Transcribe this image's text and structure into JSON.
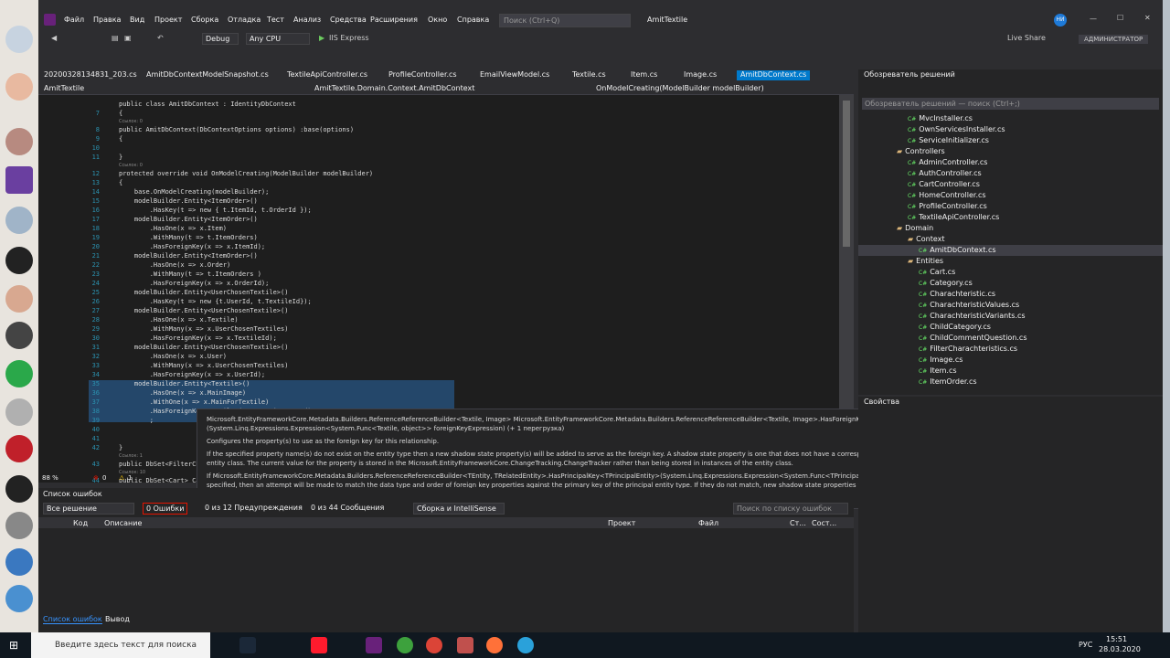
{
  "window": {
    "menu": [
      "Файл",
      "Правка",
      "Вид",
      "Проект",
      "Сборка",
      "Отладка",
      "Тест",
      "Анализ",
      "Средства",
      "Расширения",
      "Окно",
      "Справка"
    ],
    "search_placeholder": "Поиск (Ctrl+Q)",
    "title": "AmitTextile",
    "user_initials": "НИ",
    "live_share": "Live Share",
    "admin_badge": "АДМИНИСТРАТОР"
  },
  "toolbar": {
    "config": "Debug",
    "platform": "Any CPU",
    "run": "IIS Express"
  },
  "tabs": [
    "20200328134831_203.cs",
    "AmitDbContextModelSnapshot.cs",
    "TextileApiController.cs",
    "ProfileController.cs",
    "EmailViewModel.cs",
    "Textile.cs",
    "Item.cs",
    "Image.cs",
    "AmitDbContext.cs"
  ],
  "nav": {
    "project": "AmitTextile",
    "class": "AmitTextile.Domain.Context.AmitDbContext",
    "member": "OnModelCreating(ModelBuilder modelBuilder)"
  },
  "code_lines": [
    {
      "n": "",
      "t": "public class AmitDbContext : IdentityDbContext"
    },
    {
      "n": "7",
      "t": "{"
    },
    {
      "n": "",
      "t": "Ссылок: 0",
      "hint": true
    },
    {
      "n": "8",
      "t": "public AmitDbContext(DbContextOptions options) :base(options)"
    },
    {
      "n": "9",
      "t": "{"
    },
    {
      "n": "10",
      "t": ""
    },
    {
      "n": "11",
      "t": "}"
    },
    {
      "n": "",
      "t": "Ссылок: 0",
      "hint": true
    },
    {
      "n": "12",
      "t": "protected override void OnModelCreating(ModelBuilder modelBuilder)"
    },
    {
      "n": "13",
      "t": "{"
    },
    {
      "n": "14",
      "t": "    base.OnModelCreating(modelBuilder);"
    },
    {
      "n": "15",
      "t": "    modelBuilder.Entity<ItemOrder>()"
    },
    {
      "n": "16",
      "t": "        .HasKey(t => new { t.ItemId, t.OrderId });"
    },
    {
      "n": "17",
      "t": "    modelBuilder.Entity<ItemOrder>()"
    },
    {
      "n": "18",
      "t": "        .HasOne(x => x.Item)"
    },
    {
      "n": "19",
      "t": "        .WithMany(t => t.ItemOrders)"
    },
    {
      "n": "20",
      "t": "        .HasForeignKey(x => x.ItemId);"
    },
    {
      "n": "21",
      "t": "    modelBuilder.Entity<ItemOrder>()"
    },
    {
      "n": "22",
      "t": "        .HasOne(x => x.Order)"
    },
    {
      "n": "23",
      "t": "        .WithMany(t => t.ItemOrders )"
    },
    {
      "n": "24",
      "t": "        .HasForeignKey(x => x.OrderId);"
    },
    {
      "n": "25",
      "t": "    modelBuilder.Entity<UserChosenTextile>()"
    },
    {
      "n": "26",
      "t": "        .HasKey(t => new {t.UserId, t.TextileId});"
    },
    {
      "n": "27",
      "t": "    modelBuilder.Entity<UserChosenTextile>()"
    },
    {
      "n": "28",
      "t": "        .HasOne(x => x.Textile)"
    },
    {
      "n": "29",
      "t": "        .WithMany(x => x.UserChosenTextiles)"
    },
    {
      "n": "30",
      "t": "        .HasForeignKey(x => x.TextileId);"
    },
    {
      "n": "31",
      "t": "    modelBuilder.Entity<UserChosenTextile>()"
    },
    {
      "n": "32",
      "t": "        .HasOne(x => x.User)"
    },
    {
      "n": "33",
      "t": "        .WithMany(x => x.UserChosenTextiles)"
    },
    {
      "n": "34",
      "t": "        .HasForeignKey(x => x.UserId);"
    },
    {
      "n": "35",
      "t": "    modelBuilder.Entity<Textile>()"
    },
    {
      "n": "36",
      "t": "        .HasOne(x => x.MainImage)"
    },
    {
      "n": "37",
      "t": "        .WithOne(x => x.MainForTextile)"
    },
    {
      "n": "38",
      "t": "        .HasForeignKey<Textile>(x =>x.MainImageId)"
    },
    {
      "n": "39",
      "t": "        ;"
    },
    {
      "n": "40",
      "t": ""
    },
    {
      "n": "41",
      "t": ""
    },
    {
      "n": "42",
      "t": "}"
    },
    {
      "n": "",
      "t": "Ссылок: 1",
      "hint": true
    },
    {
      "n": "43",
      "t": "public DbSet<FilterCh"
    },
    {
      "n": "",
      "t": "Ссылок: 10",
      "hint": true
    },
    {
      "n": "44",
      "t": "public DbSet<Cart> Ca"
    }
  ],
  "tooltip": {
    "signature": "Microsoft.EntityFrameworkCore.Metadata.Builders.ReferenceReferenceBuilder<Textile, Image> Microsoft.EntityFrameworkCore.Metadata.Builders.ReferenceReferenceBuilder<Textile, Image>.HasForeignKey<Textile>(System.Linq.Expressions.Expression<System.Func<Textile, object>> foreignKeyExpression) (+ 1 перегрузка)",
    "summary": "Configures the property(s) to use as the foreign key for this relationship.",
    "para1": "If the specified property name(s) do not exist on the entity type then a new shadow state property(s) will be added to serve as the foreign key. A shadow state property is one that does not have a corresponding property in the entity class. The current value for the property is stored in the Microsoft.EntityFrameworkCore.ChangeTracking.ChangeTracker rather than being stored in instances of the entity class.",
    "para2": "If Microsoft.EntityFrameworkCore.Metadata.Builders.ReferenceReferenceBuilder<TEntity, TRelatedEntity>.HasPrincipalKey<TPrincipalEntity>(System.Linq.Expressions.Expression<System.Func<TPrincipalEntity, object>>) is not specified, then an attempt will be made to match the data type and order of foreign key properties against the primary key of the principal entity type. If they do not match, new shadow state properties that form a unique index will be added to the principal entity type to serve as the reference key."
  },
  "status": {
    "zoom": "88 %",
    "errors": "0",
    "warnings": "1"
  },
  "errors": {
    "title": "Список ошибок",
    "scope": "Все решение",
    "err": "0 Ошибки",
    "warn": "0 из 12 Предупреждения",
    "msg": "0 из 44 Сообщения",
    "build": "Сборка и IntelliSense",
    "search": "Поиск по списку ошибок",
    "cols": [
      "Код",
      "Описание",
      "Проект",
      "Файл",
      "Ст...",
      "Сост..."
    ],
    "tab1": "Список ошибок",
    "tab2": "Вывод"
  },
  "solution": {
    "title": "Обозреватель решений",
    "search": "Обозреватель решений — поиск (Ctrl+;)",
    "items": [
      {
        "l": "MvcInstaller.cs",
        "d": 2,
        "f": 0
      },
      {
        "l": "OwnServicesInstaller.cs",
        "d": 2,
        "f": 0
      },
      {
        "l": "ServiceInitializer.cs",
        "d": 2,
        "f": 0
      },
      {
        "l": "Controllers",
        "d": 1,
        "f": 1
      },
      {
        "l": "AdminController.cs",
        "d": 2,
        "f": 0
      },
      {
        "l": "AuthController.cs",
        "d": 2,
        "f": 0
      },
      {
        "l": "CartController.cs",
        "d": 2,
        "f": 0
      },
      {
        "l": "HomeController.cs",
        "d": 2,
        "f": 0
      },
      {
        "l": "ProfileController.cs",
        "d": 2,
        "f": 0
      },
      {
        "l": "TextileApiController.cs",
        "d": 2,
        "f": 0
      },
      {
        "l": "Domain",
        "d": 1,
        "f": 1
      },
      {
        "l": "Context",
        "d": 2,
        "f": 1
      },
      {
        "l": "AmitDbContext.cs",
        "d": 3,
        "f": 0
      },
      {
        "l": "Entities",
        "d": 2,
        "f": 1
      },
      {
        "l": "Cart.cs",
        "d": 3,
        "f": 0
      },
      {
        "l": "Category.cs",
        "d": 3,
        "f": 0
      },
      {
        "l": "Charachteristic.cs",
        "d": 3,
        "f": 0
      },
      {
        "l": "CharachteristicValues.cs",
        "d": 3,
        "f": 0
      },
      {
        "l": "CharachteristicVariants.cs",
        "d": 3,
        "f": 0
      },
      {
        "l": "ChildCategory.cs",
        "d": 3,
        "f": 0
      },
      {
        "l": "ChildCommentQuestion.cs",
        "d": 3,
        "f": 0
      },
      {
        "l": "FilterCharachteristics.cs",
        "d": 3,
        "f": 0
      },
      {
        "l": "Image.cs",
        "d": 3,
        "f": 0
      },
      {
        "l": "Item.cs",
        "d": 3,
        "f": 0
      },
      {
        "l": "ItemOrder.cs",
        "d": 3,
        "f": 0
      }
    ]
  },
  "properties": {
    "title": "Свойства"
  },
  "taskbar": {
    "search": "Введите здесь текст для поиска",
    "lang": "РУС",
    "time": "15:51",
    "date": "28.03.2020"
  }
}
